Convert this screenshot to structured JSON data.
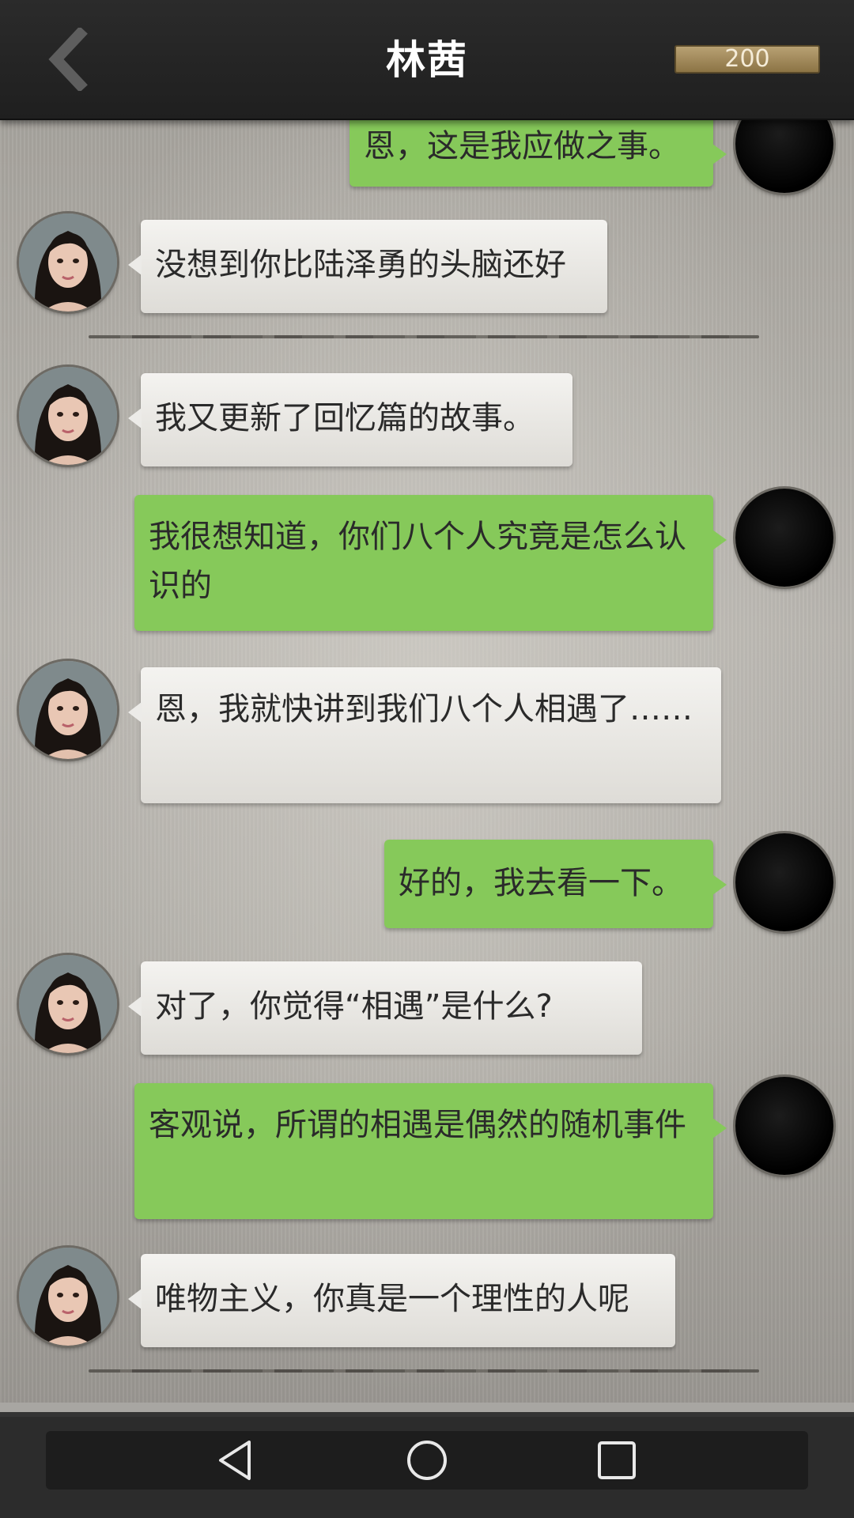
{
  "header": {
    "title": "林茜",
    "coins": "200",
    "back_icon": "chevron-left-icon"
  },
  "messages": [
    {
      "side": "out",
      "text": "恩，这是我应做之事。"
    },
    {
      "side": "in",
      "text": "没想到你比陆泽勇的头脑还好"
    },
    {
      "type": "divider"
    },
    {
      "side": "in",
      "text": "我又更新了回忆篇的故事。"
    },
    {
      "side": "out",
      "text": "我很想知道，你们八个人究竟是怎么认识的"
    },
    {
      "side": "in",
      "text": "恩，我就快讲到我们八个人相遇了……"
    },
    {
      "side": "out",
      "text": "好的，我去看一下。"
    },
    {
      "side": "in",
      "text": "对了，你觉得“相遇”是什么?"
    },
    {
      "side": "out",
      "text": "客观说，所谓的相遇是偶然的随机事件"
    },
    {
      "side": "in",
      "text": "唯物主义，你真是一个理性的人呢"
    },
    {
      "type": "divider"
    }
  ],
  "navbar": {
    "back_icon": "triangle-back-icon",
    "home_icon": "circle-home-icon",
    "recents_icon": "square-recents-icon"
  },
  "colors": {
    "outgoing_bubble": "#86c95a",
    "incoming_bubble": "#efeeeb",
    "topbar": "#242424"
  }
}
